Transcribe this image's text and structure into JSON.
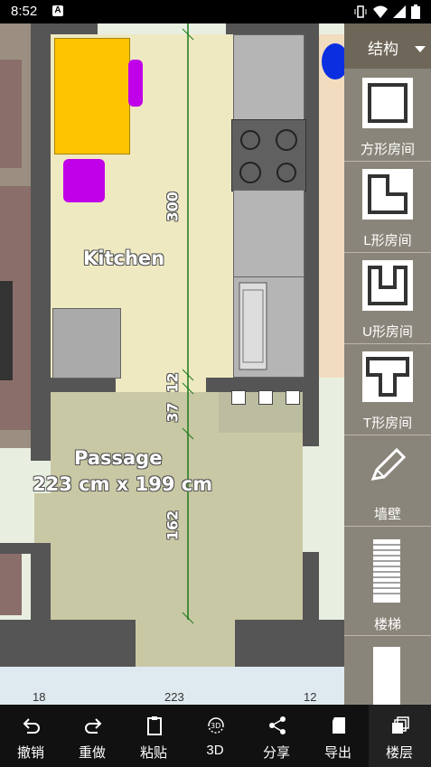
{
  "status": {
    "time": "8:52",
    "notification": "A"
  },
  "rooms": {
    "kitchen": {
      "name": "Kitchen",
      "dim_vertical": "300"
    },
    "passage": {
      "name": "Passage",
      "size": "223 cm x 199 cm",
      "dim_vertical": "162"
    },
    "dim_small_1": "37",
    "dim_small_2": "12",
    "bottom_dims": [
      "18",
      "223",
      "12"
    ]
  },
  "panel": {
    "header": "结构",
    "tools": [
      "方形房间",
      "L形房间",
      "U形房间",
      "T形房间",
      "墙壁",
      "楼梯"
    ]
  },
  "toolbar": {
    "undo": "撤销",
    "redo": "重做",
    "paste": "粘贴",
    "view3d": "3D",
    "share": "分享",
    "export": "导出",
    "floors": "楼层"
  },
  "icon_3d_text": "3D"
}
